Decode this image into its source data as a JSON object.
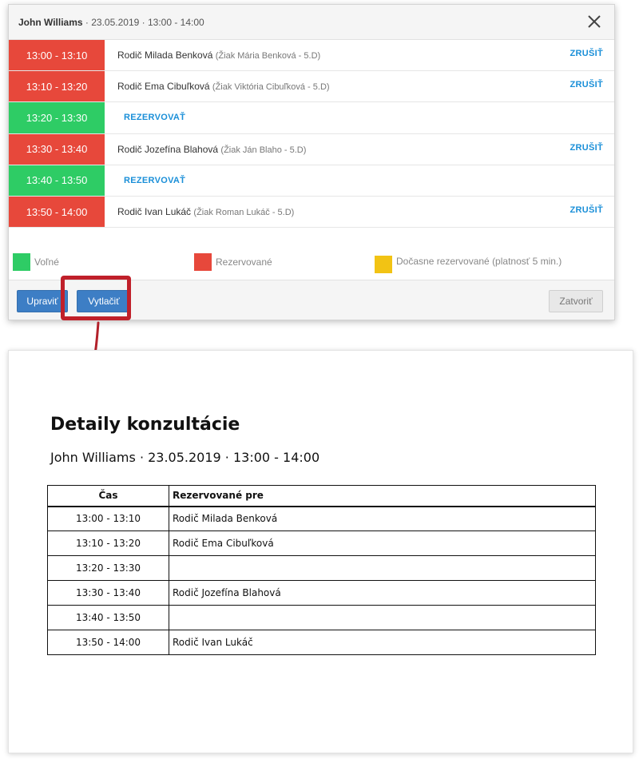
{
  "modal": {
    "title_name": "John Williams",
    "title_details": " · 23.05.2019 · 13:00 - 14:00",
    "close_icon": "close-icon",
    "slots": [
      {
        "time": "13:00 - 13:10",
        "status": "reserved",
        "parent": "Rodič Milada Benková",
        "student": "(Žiak Mária Benková - 5.D)",
        "action": "ZRUŠIŤ"
      },
      {
        "time": "13:10 - 13:20",
        "status": "reserved",
        "parent": "Rodič Ema Cibuľková",
        "student": "(Žiak Viktória Cibuľková - 5.D)",
        "action": "ZRUŠIŤ"
      },
      {
        "time": "13:20 - 13:30",
        "status": "free",
        "action": "REZERVOVAŤ"
      },
      {
        "time": "13:30 - 13:40",
        "status": "reserved",
        "parent": "Rodič Jozefína Blahová",
        "student": "(Žiak Ján Blaho - 5.D)",
        "action": "ZRUŠIŤ"
      },
      {
        "time": "13:40 - 13:50",
        "status": "free",
        "action": "REZERVOVAŤ"
      },
      {
        "time": "13:50 - 14:00",
        "status": "reserved",
        "parent": "Rodič Ivan Lukáč",
        "student": "(Žiak Roman Lukáč - 5.D)",
        "action": "ZRUŠIŤ"
      }
    ],
    "legend": {
      "free_label": "Voľné",
      "reserved_label": "Rezervované",
      "temp_label": "Dočasne rezervované (platnosť 5 min.)"
    },
    "footer": {
      "edit_label": "Upraviť",
      "print_label": "Vytlačiť",
      "close_label": "Zatvoriť"
    }
  },
  "colors": {
    "reserved": "#e7483b",
    "free": "#2ecc65",
    "temporary": "#f2c314",
    "link": "#1a8fd8",
    "primary_button": "#3d7ec5",
    "highlight": "#c0202a"
  },
  "print": {
    "title": "Detaily konzultácie",
    "subtitle": "John Williams · 23.05.2019 · 13:00 - 14:00",
    "headers": [
      "Čas",
      "Rezervované pre"
    ],
    "rows": [
      {
        "time": "13:00 - 13:10",
        "reserved_for": "Rodič Milada Benková"
      },
      {
        "time": "13:10 - 13:20",
        "reserved_for": "Rodič Ema Cibuľková"
      },
      {
        "time": "13:20 - 13:30",
        "reserved_for": ""
      },
      {
        "time": "13:30 - 13:40",
        "reserved_for": "Rodič Jozefína Blahová"
      },
      {
        "time": "13:40 - 13:50",
        "reserved_for": ""
      },
      {
        "time": "13:50 - 14:00",
        "reserved_for": "Rodič Ivan Lukáč"
      }
    ]
  }
}
